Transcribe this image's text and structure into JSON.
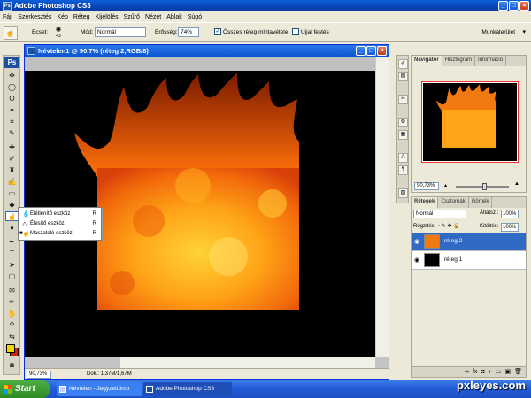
{
  "app": {
    "title": "Adobe Photoshop CS3",
    "logo": "Ps"
  },
  "window_buttons": {
    "minimize": "_",
    "maximize": "□",
    "close": "×"
  },
  "menu": [
    "Fájl",
    "Szerkesztés",
    "Kép",
    "Réteg",
    "Kijelölés",
    "Szűrő",
    "Nézet",
    "Ablak",
    "Súgó"
  ],
  "options": {
    "brush_label": "Ecset:",
    "brush_size": "43",
    "mode_label": "Mód:",
    "mode_value": "Normál",
    "strength_label": "Erősség:",
    "strength_value": "74%",
    "sample_all_label": "Összes réteg mintavétele",
    "finger_paint_label": "Ujjal festés",
    "workspace_label": "Munkaterület"
  },
  "document": {
    "title": "Névtelen1 @ 90,7% (réteg 2,RGB/8)",
    "zoom": "90,73%",
    "info": "Dok.: 1,37M/1,67M"
  },
  "flyout": [
    {
      "label": "Élétlenítő eszköz",
      "key": "R",
      "icon": "drop-icon"
    },
    {
      "label": "Élesítő eszköz",
      "key": "R",
      "icon": "triangle-icon"
    },
    {
      "label": "Maszatoló eszköz",
      "key": "R",
      "icon": "smudge-icon",
      "selected": true
    }
  ],
  "navigator": {
    "tabs": [
      "Navigátor",
      "Hisztogram",
      "Információ"
    ],
    "zoom": "90,73%"
  },
  "layers": {
    "tabs": [
      "Rétegek",
      "Csatornák",
      "Görbék"
    ],
    "blend_mode": "Normál",
    "opacity_label": "Átlátsz.:",
    "opacity_value": "100%",
    "lock_label": "Rögzítés:",
    "fill_label": "Kitöltés:",
    "fill_value": "100%",
    "items": [
      {
        "name": "réteg 2",
        "active": true
      },
      {
        "name": "réteg 1",
        "active": false
      }
    ]
  },
  "taskbar": {
    "start": "Start",
    "tasks": [
      "Névtelen - Jegyzettömb",
      "Adobe Photoshop CS3"
    ]
  },
  "watermark": "pxleyes.com",
  "colors": {
    "foreground": "#f5d400",
    "background": "#d81e05",
    "accent": "#0a5fd8"
  }
}
